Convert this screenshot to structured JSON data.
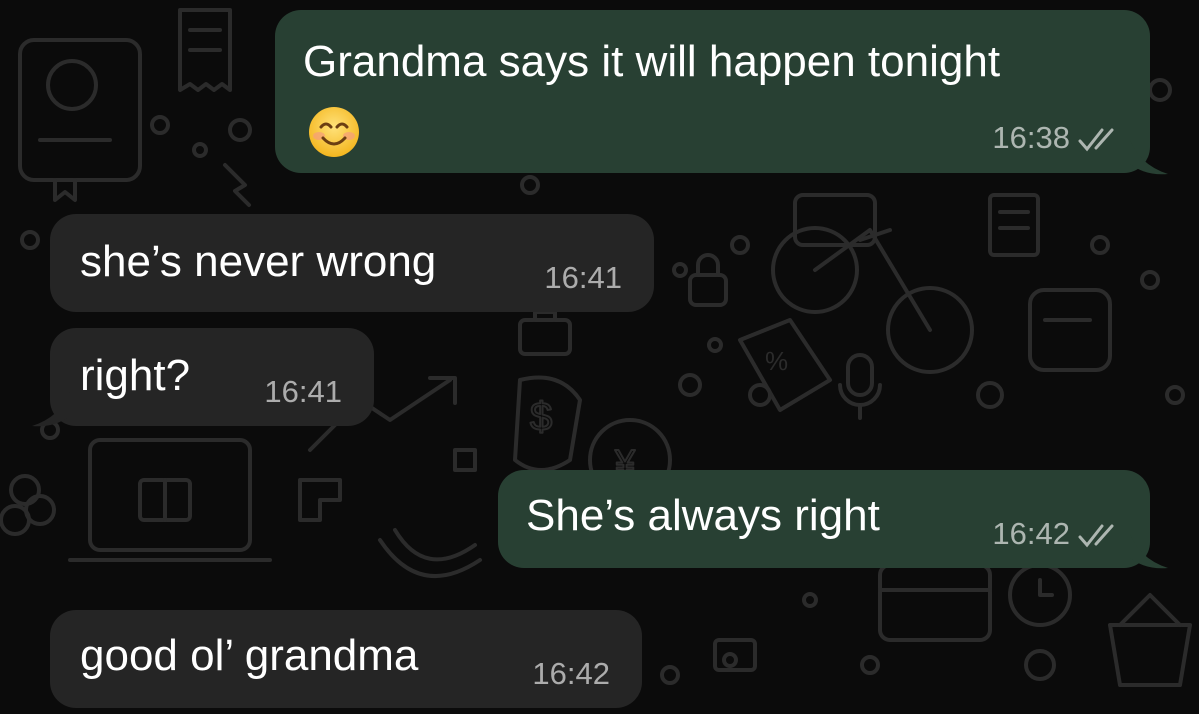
{
  "messages": [
    {
      "direction": "outgoing",
      "text": "Grandma says it will happen tonight",
      "emoji": "smiling-face",
      "time": "16:38",
      "status": "read"
    },
    {
      "direction": "incoming",
      "text": "she’s never wrong",
      "time": "16:41"
    },
    {
      "direction": "incoming",
      "text": "right?",
      "time": "16:41"
    },
    {
      "direction": "outgoing",
      "text": "She’s always right",
      "time": "16:42",
      "status": "read"
    },
    {
      "direction": "incoming",
      "text": "good ol’ grandma",
      "time": "16:42"
    }
  ],
  "colors": {
    "background": "#0b0b0b",
    "outgoing_bubble": "#284033",
    "incoming_bubble": "#252525",
    "doodle": "#2a2a2a",
    "timestamp": "#9e9e9e"
  },
  "icons": {
    "read_receipt": "double-check-icon",
    "wallpaper": "doodle-pattern"
  }
}
